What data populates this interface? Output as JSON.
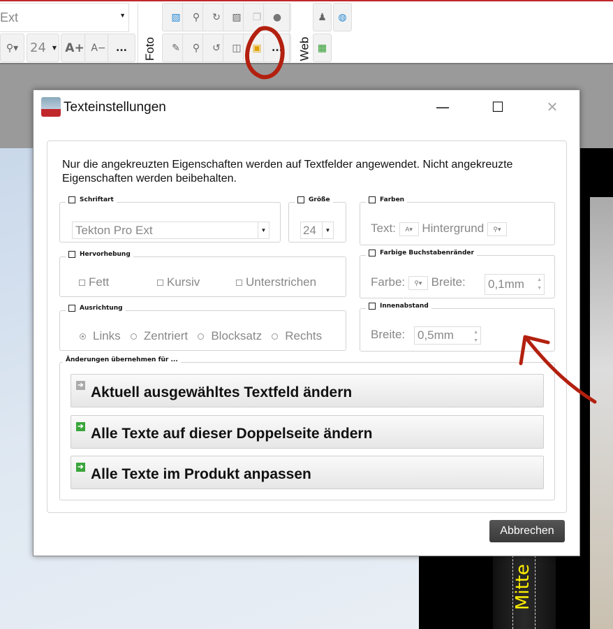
{
  "toolbar": {
    "font_combo_value": "Ext",
    "font_size": "24",
    "grow_font": "A+",
    "shrink_font": "A−",
    "more": "...",
    "foto_label": "Foto",
    "web_label": "Web"
  },
  "dialog": {
    "title": "Texteinstellungen",
    "minimize": "—",
    "maximize": "☐",
    "close": "✕",
    "intro": "Nur die angekreuzten Eigenschaften werden auf Textfelder angewendet. Nicht angekreuzte Eigenschaften werden beibehalten.",
    "schriftart": {
      "label": "Schriftart",
      "value": "Tekton Pro Ext"
    },
    "groesse": {
      "label": "Größe",
      "value": "24"
    },
    "farben": {
      "label": "Farben",
      "text_label": "Text:",
      "bg_label": "Hintergrund"
    },
    "hervorhebung": {
      "label": "Hervorhebung",
      "options": [
        "Fett",
        "Kursiv",
        "Unterstrichen"
      ]
    },
    "buchstabenraender": {
      "label": "Farbige Buchstabenränder",
      "farbe_label": "Farbe:",
      "breite_label": "Breite:",
      "breite_value": "0,1mm"
    },
    "ausrichtung": {
      "label": "Ausrichtung",
      "options": [
        "Links",
        "Zentriert",
        "Blocksatz",
        "Rechts"
      ],
      "selected": "Links"
    },
    "innenabstand": {
      "label": "Innenabstand",
      "breite_label": "Breite:",
      "breite_value": "0,5mm"
    },
    "apply": {
      "label": "Änderungen übernehmen für ...",
      "buttons": [
        "Aktuell ausgewähltes Textfeld ändern",
        "Alle Texte auf dieser Doppelseite ändern",
        "Alle Texte im Produkt anpassen"
      ]
    },
    "cancel": "Abbrechen"
  },
  "canvas": {
    "spine_text": "Mitte"
  },
  "colors": {
    "accent_red": "#c0282c",
    "annotation": "#b3200f",
    "highlight": "#ffee00"
  }
}
